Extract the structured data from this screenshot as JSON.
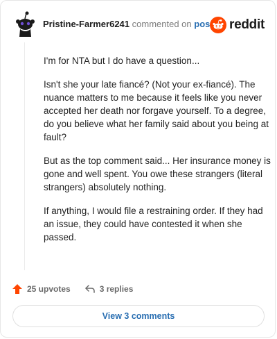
{
  "header": {
    "username": "Pristine-Farmer6241",
    "action_text": "commented on",
    "post_link": "post",
    "logo_text": "reddit"
  },
  "comment": {
    "paragraphs": [
      "I'm for NTA but I do have a question...",
      "Isn't she your late fiancé? (Not your ex-fiancé). The nuance matters to me because it feels like you never accepted her death nor forgave yourself. To a degree, do you believe what her family said about you being at fault?",
      "But as the top comment said... Her insurance money is gone and well spent. You owe these strangers (literal strangers) absolutely nothing.",
      "If anything, I would file a restraining order. If they had an issue, they could have contested it when she passed."
    ]
  },
  "footer": {
    "upvotes": "25 upvotes",
    "replies": "3 replies",
    "upvote_icon": "upvote-arrow-icon",
    "reply_icon": "reply-arrow-icon"
  },
  "view_button": {
    "label": "View 3 comments"
  },
  "colors": {
    "accent_orange": "#ff4500",
    "link_blue": "#2a6fb2",
    "muted_gray": "#7c7c7c"
  }
}
